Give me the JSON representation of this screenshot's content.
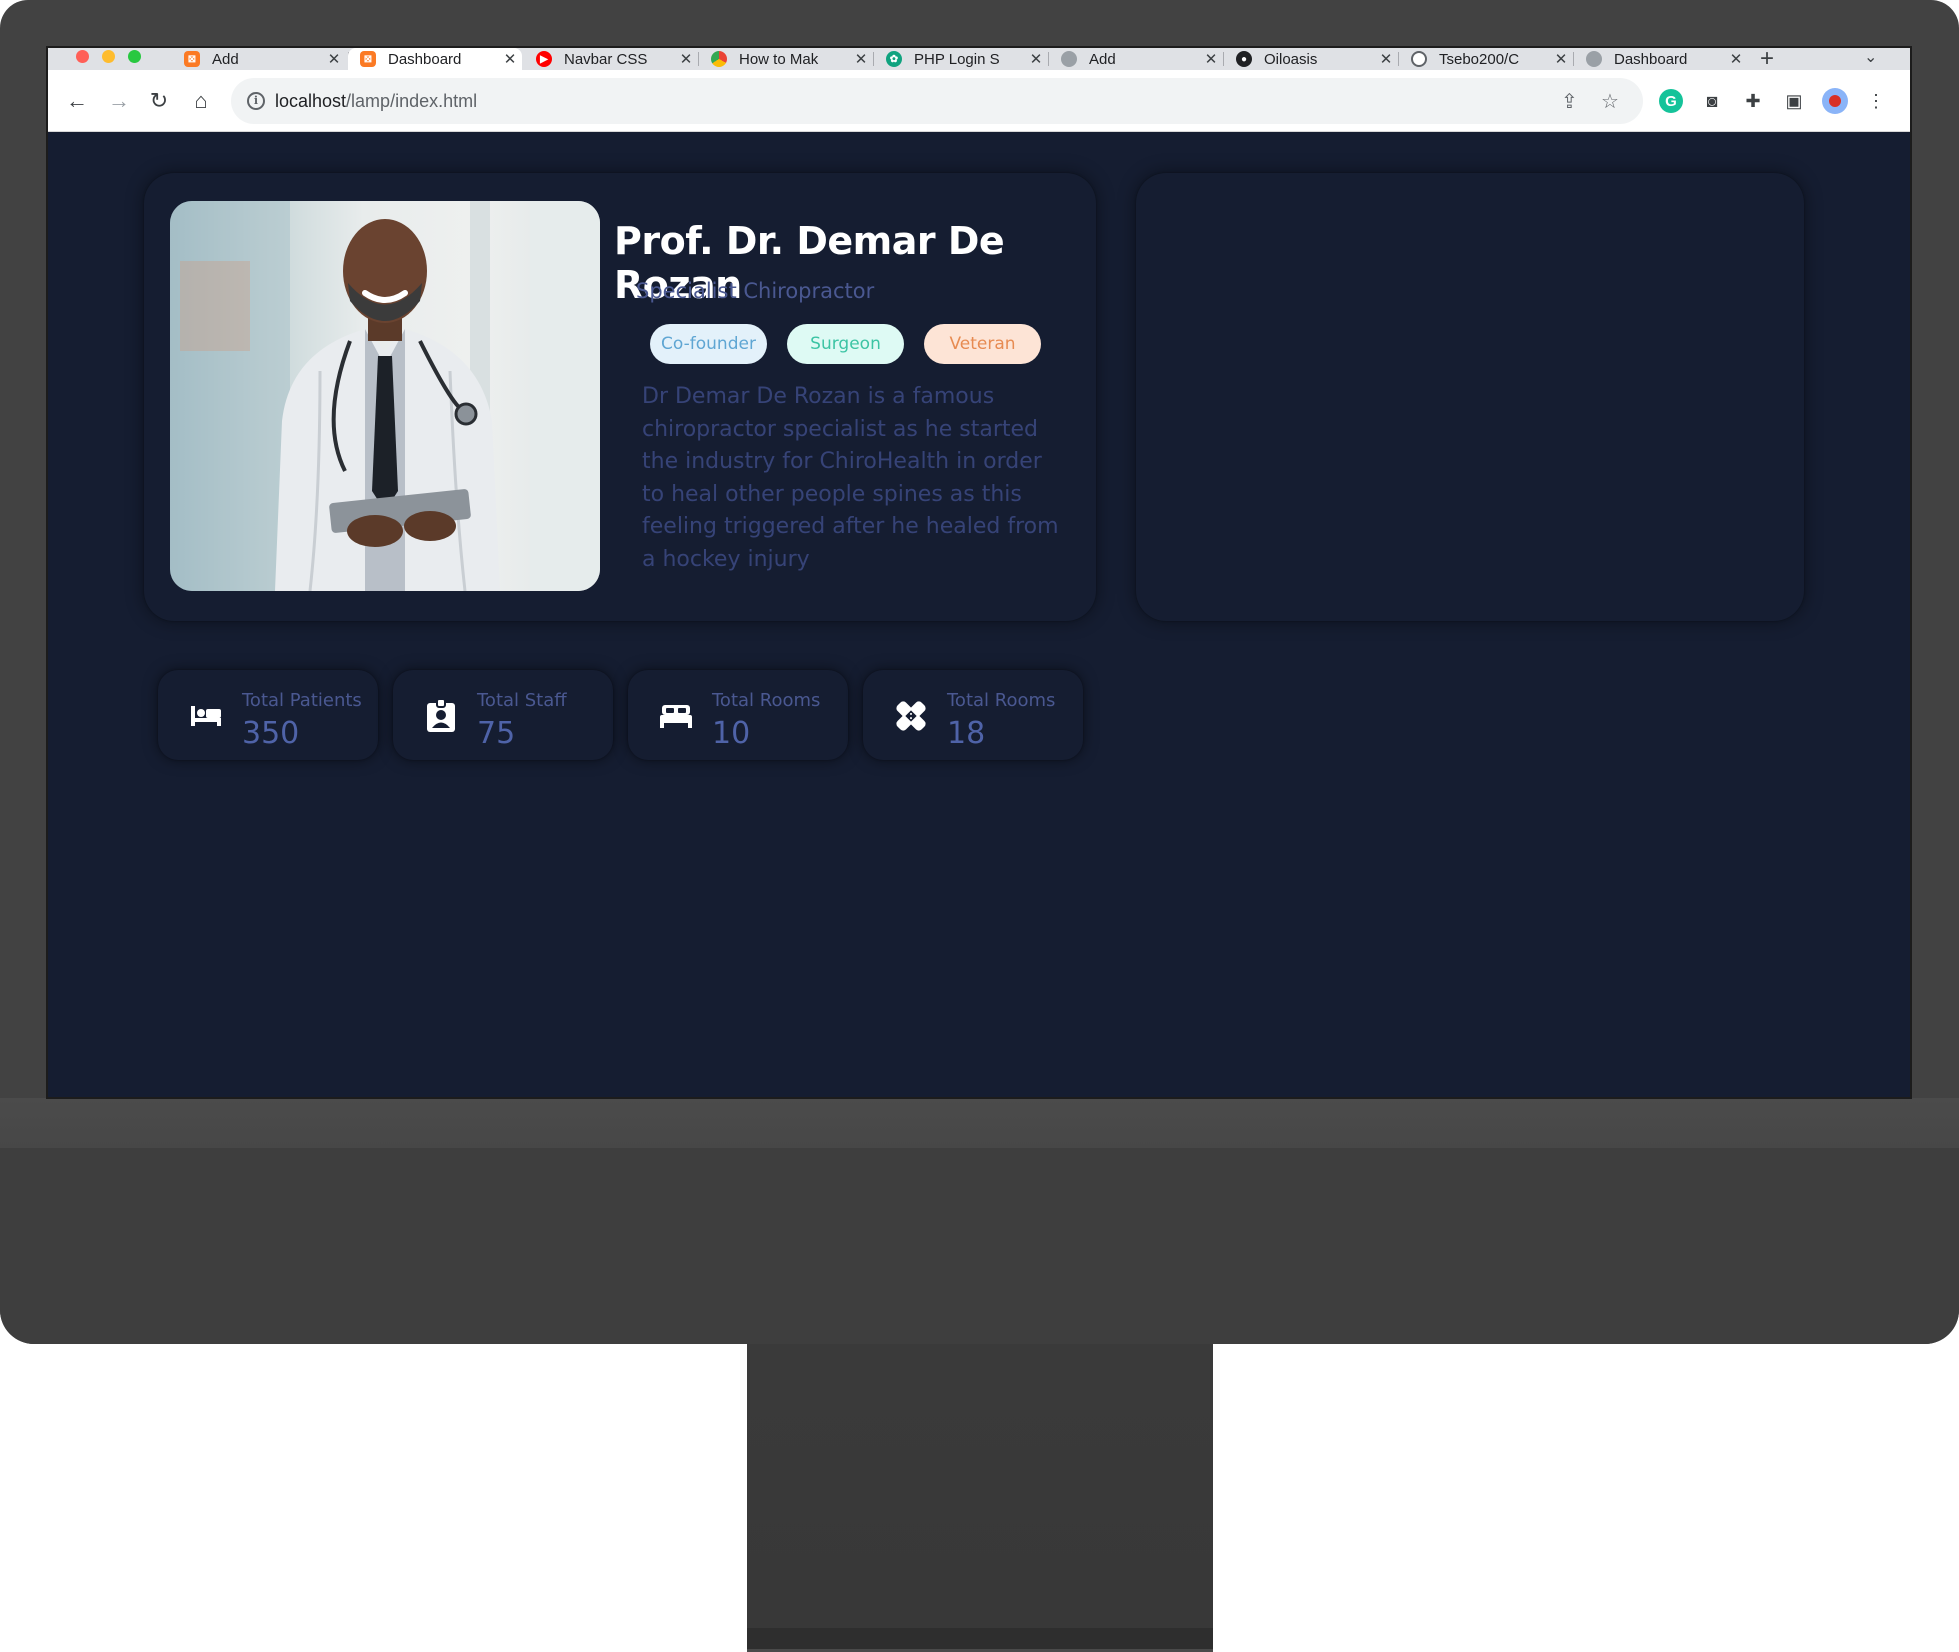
{
  "browser": {
    "tabs": [
      {
        "label": "Add",
        "icon": "xampp-icon",
        "color": "#fb7a24"
      },
      {
        "label": "Dashboard",
        "icon": "xampp-icon",
        "color": "#fb7a24",
        "active": true
      },
      {
        "label": "Navbar CSS",
        "icon": "youtube-icon",
        "color": "#ff0000"
      },
      {
        "label": "How to Mak",
        "icon": "chrome-icon",
        "color": "#4285f4"
      },
      {
        "label": "PHP Login S",
        "icon": "chatgpt-icon",
        "color": "#10a37f"
      },
      {
        "label": "Add",
        "icon": "globe-icon",
        "color": "#9aa0a6"
      },
      {
        "label": "Oiloasis",
        "icon": "oiloasis-icon",
        "color": "#202124"
      },
      {
        "label": "Tsebo200/C",
        "icon": "github-icon",
        "color": "#ffffff"
      },
      {
        "label": "Dashboard",
        "icon": "globe-icon",
        "color": "#9aa0a6"
      }
    ],
    "url_host": "localhost",
    "url_path": "/lamp/index.html"
  },
  "profile": {
    "name": "Prof. Dr. Demar De Rozan",
    "title": "Specialist Chiropractor",
    "tags": [
      "Co-founder",
      "Surgeon",
      "Veteran"
    ],
    "bio": "Dr Demar De Rozan is a famous chiropractor specialist as he started the industry for ChiroHealth in order to heal other people spines as this feeling triggered after he healed from a hockey injury"
  },
  "stats": [
    {
      "label": "Total Patients",
      "value": "350",
      "icon": "bed-patient-icon"
    },
    {
      "label": "Total Staff",
      "value": "75",
      "icon": "id-badge-icon"
    },
    {
      "label": "Total Rooms",
      "value": "10",
      "icon": "bed-icon"
    },
    {
      "label": "Total Rooms",
      "value": "18",
      "icon": "bandage-icon"
    }
  ],
  "colors": {
    "page_bg": "#151d31",
    "muted_text": "#4a5891",
    "tag_cofounder": "#5fa6d3",
    "tag_surgeon": "#3cc4a4",
    "tag_veteran": "#e78b52"
  }
}
